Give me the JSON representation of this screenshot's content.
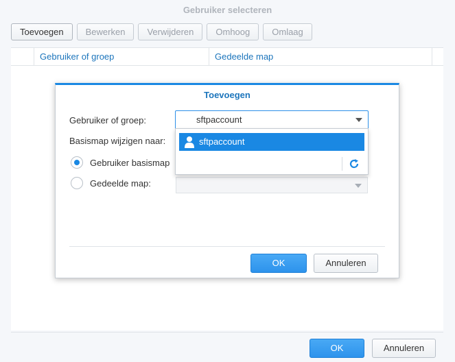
{
  "outer": {
    "title": "Gebruiker selecteren",
    "toolbar": {
      "add": "Toevoegen",
      "edit": "Bewerken",
      "delete": "Verwijderen",
      "up": "Omhoog",
      "down": "Omlaag"
    },
    "columns": {
      "user_or_group": "Gebruiker of groep",
      "shared_folder": "Gedeelde map"
    },
    "ok": "OK",
    "cancel": "Annuleren"
  },
  "dialog": {
    "title": "Toevoegen",
    "user_label": "Gebruiker of groep:",
    "user_value": "sftpaccount",
    "basedir_label": "Basismap wijzigen naar:",
    "radio_user_home": "Gebruiker basismap",
    "radio_shared": "Gedeelde map:",
    "ok": "OK",
    "cancel": "Annuleren"
  },
  "dropdown": {
    "items": [
      {
        "label": "sftpaccount"
      }
    ]
  },
  "colors": {
    "accent": "#1a88e3",
    "link": "#1c75bc"
  }
}
